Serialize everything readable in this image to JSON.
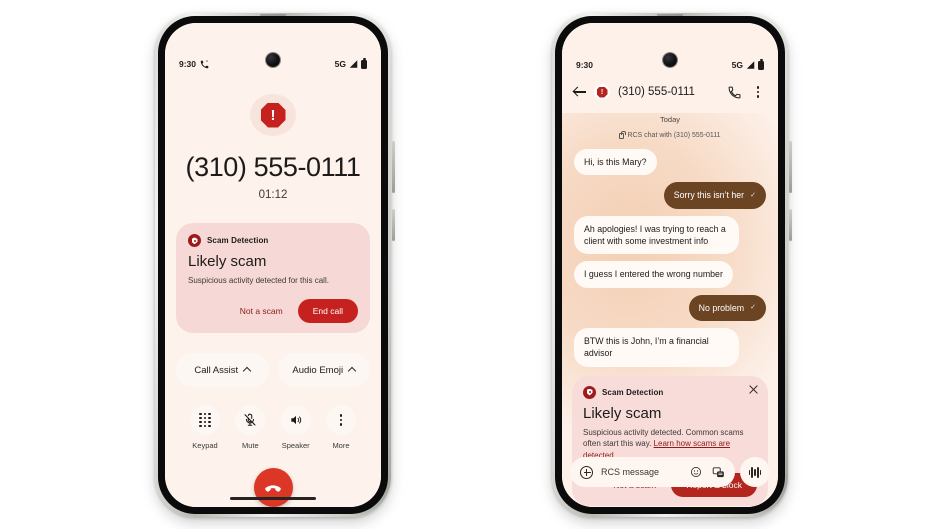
{
  "left_phone": {
    "status_bar": {
      "time": "9:30",
      "call_icon": "phone-call-icon",
      "network": "5G",
      "signal_icon": "signal-bars-icon",
      "battery_icon": "battery-icon"
    },
    "alert_icon": "octagon-exclamation-icon",
    "caller_number": "(310) 555-0111",
    "call_duration": "01:12",
    "scam_card": {
      "badge_icon": "shield-scam-icon",
      "label": "Scam Detection",
      "title": "Likely scam",
      "description": "Suspicious activity detected for this call.",
      "secondary_action": "Not a scam",
      "primary_action": "End call",
      "card_bg": "#f6d9d6",
      "primary_color": "#c5221f"
    },
    "assist": [
      {
        "label": "Call Assist",
        "chevron": "chevron-up-icon"
      },
      {
        "label": "Audio Emoji",
        "chevron": "chevron-up-icon"
      }
    ],
    "controls": [
      {
        "label": "Keypad",
        "icon": "keypad-icon"
      },
      {
        "label": "Mute",
        "icon": "mic-off-icon"
      },
      {
        "label": "Speaker",
        "icon": "speaker-icon"
      },
      {
        "label": "More",
        "icon": "more-vertical-icon"
      }
    ],
    "end_call_icon": "end-call-icon",
    "end_call_color": "#dc3626",
    "screen_bg": "#fdf2ec"
  },
  "right_phone": {
    "status_bar": {
      "time": "9:30",
      "network": "5G",
      "signal_icon": "signal-bars-icon",
      "battery_icon": "battery-icon"
    },
    "app_bar": {
      "back_icon": "back-arrow-icon",
      "contact_badge_icon": "octagon-exclamation-icon",
      "title": "(310) 555-0111",
      "call_icon": "phone-icon",
      "overflow_icon": "more-vertical-icon"
    },
    "day_label": "Today",
    "rcs_label": "RCS chat with (310) 555-0111",
    "rcs_lock_icon": "lock-icon",
    "messages": [
      {
        "side": "in",
        "text": "Hi, is this Mary?"
      },
      {
        "side": "out",
        "text": "Sorry this isn’t her",
        "status_icon": "delivered-check-icon"
      },
      {
        "side": "in",
        "text": "Ah apologies! I was trying to reach a client with some investment info"
      },
      {
        "side": "in",
        "text": "I guess I entered the wrong number"
      },
      {
        "side": "out",
        "text": "No problem",
        "status_icon": "delivered-check-icon"
      },
      {
        "side": "in",
        "text": "BTW this is John, I’m a financial advisor"
      }
    ],
    "scam_card": {
      "badge_icon": "shield-scam-icon",
      "label": "Scam Detection",
      "close_icon": "close-icon",
      "title": "Likely scam",
      "description": "Suspicious activity detected. Common scams often start this way. ",
      "link_text": "Learn how scams are detected",
      "secondary_action": "Not a scam",
      "primary_action": "Report & block",
      "card_bg": "#f8dcd9",
      "primary_color": "#b3261e"
    },
    "composer": {
      "plus_icon": "plus-circle-icon",
      "placeholder": "RCS message",
      "emoji_icon": "emoji-icon",
      "gallery_icon": "gallery-icon",
      "mic_icon": "voice-waveform-icon"
    },
    "bubble_in_bg": "#fffaf6",
    "bubble_out_bg": "#6b4423",
    "screen_bg": "#fdf1ea"
  }
}
